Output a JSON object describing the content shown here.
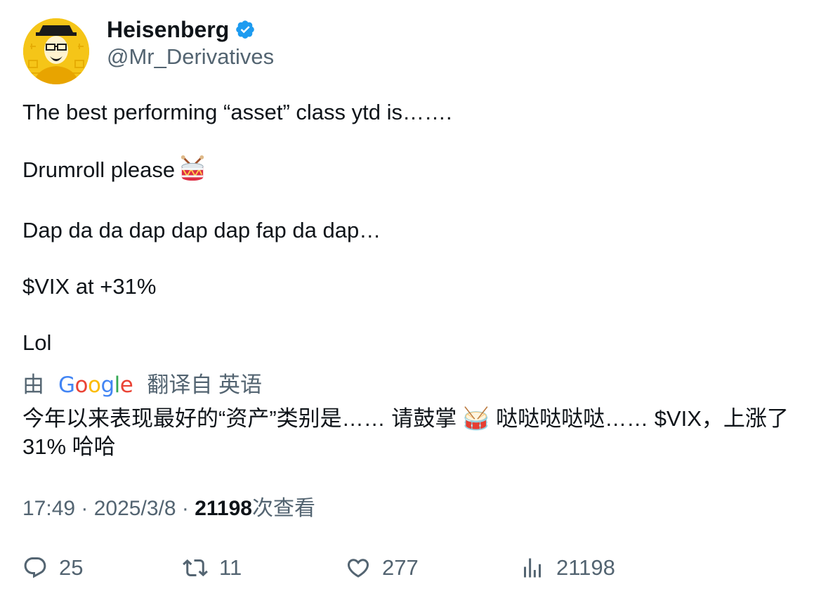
{
  "tweet": {
    "author": {
      "name": "Heisenberg",
      "handle": "@Mr_Derivatives",
      "verified": true,
      "avatar_icon": "heisenberg-avatar"
    },
    "text_paragraphs": [
      "The best performing “asset” class ytd is…….",
      "Drumroll please",
      "Dap da da dap dap dap fap da dap…",
      "$VIX at +31%",
      "Lol"
    ],
    "translation": {
      "prefix": "由",
      "provider": "Google",
      "suffix": "翻译自 英语",
      "text": "今年以来表现最好的“资产”类别是…… 请鼓掌 🥁 哒哒哒哒哒…… $VIX，上涨了 31% 哈哈"
    },
    "meta": {
      "time": "17:49",
      "date": "2025/3/8",
      "views": "21198",
      "views_label": "次查看"
    },
    "actions": {
      "replies": "25",
      "retweets": "11",
      "likes": "277",
      "views": "21198"
    }
  },
  "colors": {
    "text_primary": "#0f1419",
    "text_secondary": "#536471",
    "verified_blue": "#1d9bf0",
    "avatar_yellow": "#f5c518"
  }
}
